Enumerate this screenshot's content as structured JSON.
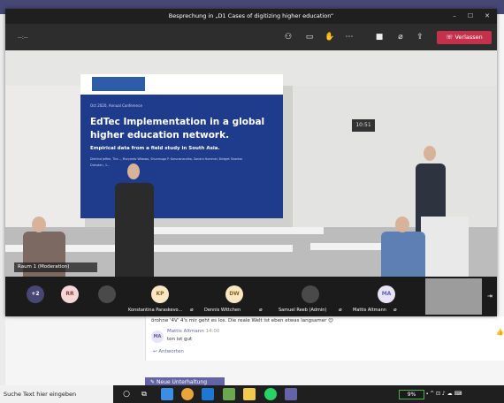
{
  "window": {
    "title": "Besprechung in „D1 Cases of digitizing higher education“",
    "minimize": "–",
    "maximize": "☐",
    "close": "✕"
  },
  "controls": {
    "timer": "--:--",
    "leave_label": "Verlassen",
    "icons": [
      "people-icon",
      "chat-icon",
      "raise-hand-icon",
      "more-icon",
      "camera-icon",
      "mic-off-icon",
      "share-icon",
      "phone-icon"
    ]
  },
  "video": {
    "slide_header": "Oct 2020, Annual Conference",
    "slide_title_1": "EdTec Implementation in a global",
    "slide_title_2": "higher education network.",
    "slide_subtitle": "Empirical data from a field study in South Asia.",
    "slide_authors": "Dietlind Jaffee, The..., Muryanto Wibowo, Shunmuga P. Karunanandha, Sandra Hummel, Bridget Shankar",
    "slide_location": "Dresden, 1...",
    "clock": "10:51",
    "speaker_label": "Raum 1 (Moderation)"
  },
  "participants": {
    "overflow": "+2",
    "tiles": [
      {
        "initials": "RR",
        "name": "",
        "color": "#f4d7d7",
        "text_color": "#9b3b3b"
      },
      {
        "initials": "",
        "name": "",
        "photo": true
      },
      {
        "initials": "KP",
        "name": "Konstantina Paraskevo...",
        "color": "#f8e7c2",
        "text_color": "#8a6217"
      },
      {
        "initials": "DW",
        "name": "Dennis Wittchen",
        "color": "#f8e7c2",
        "text_color": "#8a6217"
      },
      {
        "initials": "",
        "name": "Samuel Reeb (Admin)",
        "photo": true
      },
      {
        "initials": "MA",
        "name": "Mattis Altmann",
        "color": "#e8e3f5",
        "text_color": "#6264a7"
      }
    ]
  },
  "chat": {
    "prev_message": "örohne '4V' 4's mir geht es los. Die reale Welt ist eben etwas langsamer 😊",
    "author": "Mattis Altmann",
    "time": "14:00",
    "message": "ton ist gut",
    "reply": "Antworten",
    "new_conversation": "Neue Unterhaltung"
  },
  "taskbar": {
    "search_placeholder": "Suche Text hier eingeben",
    "battery": "9%"
  }
}
